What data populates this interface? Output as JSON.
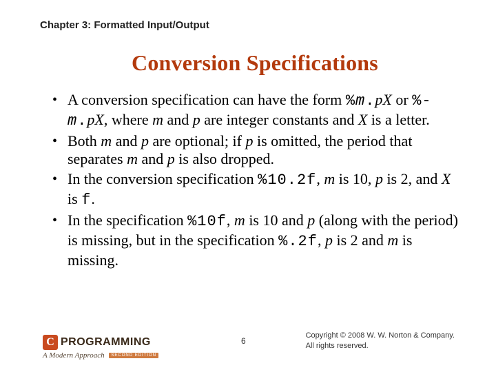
{
  "chapter": "Chapter 3: Formatted Input/Output",
  "title": "Conversion Specifications",
  "bullets": {
    "b1": {
      "t1": "A conversion specification can have the form ",
      "c1": "%",
      "i1": "m",
      "c2": ".",
      "i2": "pX",
      "t2": " or ",
      "c3": "%-",
      "i3": "m",
      "c4": ".",
      "i4": "pX",
      "t3": ", where ",
      "i5": "m",
      "t4": " and ",
      "i6": "p",
      "t5": " are integer constants and ",
      "i7": "X",
      "t6": " is a letter."
    },
    "b2": {
      "t1": "Both ",
      "i1": "m",
      "t2": " and ",
      "i2": "p",
      "t3": " are optional; if ",
      "i3": "p",
      "t4": " is omitted, the period that separates ",
      "i4": "m",
      "t5": " and ",
      "i5": "p",
      "t6": " is also dropped."
    },
    "b3": {
      "t1": "In the conversion specification ",
      "c1": "%10.2f",
      "t2": ", ",
      "i1": "m",
      "t3": " is 10, ",
      "i2": "p",
      "t4": " is 2, and ",
      "i3": "X",
      "t5": " is ",
      "c2": "f",
      "t6": "."
    },
    "b4": {
      "t1": "In the specification ",
      "c1": "%10f",
      "t2": ", ",
      "i1": "m",
      "t3": " is 10 and ",
      "i2": "p",
      "t4": " (along with the period) is missing, but in the specification ",
      "c2": "%.2f",
      "t5": ", ",
      "i3": "p",
      "t6": " is 2 and ",
      "i4": "m",
      "t7": " is missing."
    }
  },
  "footer": {
    "logo_c": "C",
    "logo_word": "PROGRAMMING",
    "logo_sub": "A Modern Approach",
    "logo_ed": "SECOND EDITION",
    "page": "6",
    "copy1": "Copyright © 2008 W. W. Norton & Company.",
    "copy2": "All rights reserved."
  }
}
